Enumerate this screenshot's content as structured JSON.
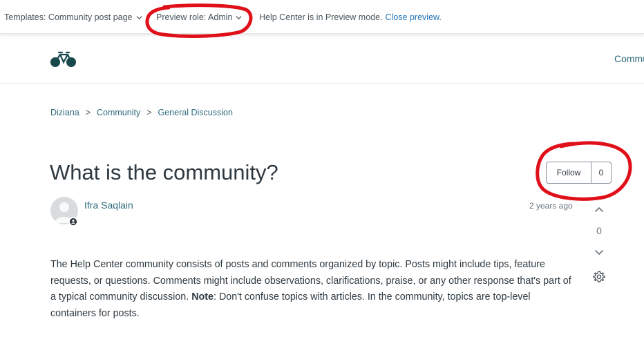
{
  "preview_bar": {
    "templates_label": "Templates: Community post page",
    "role_label": "Preview role: Admin",
    "message": "Help Center is in Preview mode.",
    "close_link": "Close preview."
  },
  "header": {
    "logo_icon": "bicycle-icon",
    "nav_link": "Commu"
  },
  "breadcrumb": {
    "items": [
      "Diziana",
      "Community",
      "General Discussion"
    ],
    "separator": ">"
  },
  "post": {
    "title": "What is the community?",
    "follow_label": "Follow",
    "follow_count": "0",
    "author": "Ifra Saqlain",
    "date": "2 years ago",
    "vote_count": "0",
    "body_part1": "The Help Center community consists of posts and comments organized by topic. Posts might include tips, feature requests, or questions. Comments might include observations, clarifications, praise, or any other response that's part of a typical community discussion. ",
    "body_bold": "Note",
    "body_part2": ": Don't confuse topics with articles. In the community, topics are top-level containers for posts."
  },
  "colors": {
    "annotation_red": "#e0101a",
    "link": "#1f73b7",
    "brand_teal": "#2f6a7a"
  }
}
